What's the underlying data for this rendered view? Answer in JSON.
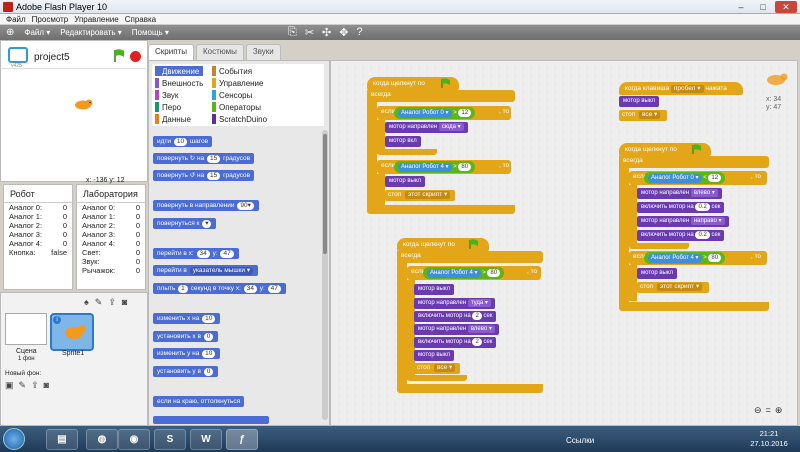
{
  "window": {
    "title": "Adobe Flash Player 10"
  },
  "menu": {
    "items": [
      "Файл",
      "Просмотр",
      "Управление",
      "Справка"
    ]
  },
  "toolbar": {
    "file": "Файл ▾",
    "edit": "Редактировать ▾",
    "help": "Помощь ▾"
  },
  "stage": {
    "project": "project5",
    "coords": "x: -136  y: 12",
    "tiny_label": "v425"
  },
  "boards": {
    "robot": {
      "title": "Робот",
      "rows": [
        {
          "k": "Аналог 0:",
          "v": "0"
        },
        {
          "k": "Аналог 1:",
          "v": "0"
        },
        {
          "k": "Аналог 2:",
          "v": "0"
        },
        {
          "k": "Аналог 3:",
          "v": "0"
        },
        {
          "k": "Аналог 4:",
          "v": "0"
        },
        {
          "k": "Кнопка:",
          "v": "false"
        }
      ]
    },
    "lab": {
      "title": "Лаборатория",
      "rows": [
        {
          "k": "Аналог 0:",
          "v": "0"
        },
        {
          "k": "Аналог 1:",
          "v": "0"
        },
        {
          "k": "Аналог 2:",
          "v": "0"
        },
        {
          "k": "Аналог 3:",
          "v": "0"
        },
        {
          "k": "Аналог 4:",
          "v": "0"
        },
        {
          "k": "Свет:",
          "v": "0"
        },
        {
          "k": "Звук:",
          "v": "0"
        },
        {
          "k": "Рычажок:",
          "v": "0"
        }
      ]
    }
  },
  "sprites": {
    "stage_label": "Сцена",
    "stage_sub": "1 фон",
    "new_bg": "Новый фон:",
    "sprite_name": "Sprite1"
  },
  "tabs": [
    "Скрипты",
    "Костюмы",
    "Звуки"
  ],
  "categories": [
    {
      "label": "Движение",
      "color": "#4a6cd4"
    },
    {
      "label": "События",
      "color": "#c88330"
    },
    {
      "label": "Внешность",
      "color": "#8a55d7"
    },
    {
      "label": "Управление",
      "color": "#e1a91a"
    },
    {
      "label": "Звук",
      "color": "#bb42c3"
    },
    {
      "label": "Сенсоры",
      "color": "#2ca5e2"
    },
    {
      "label": "Перо",
      "color": "#0e9a6c"
    },
    {
      "label": "Операторы",
      "color": "#5cb712"
    },
    {
      "label": "Данные",
      "color": "#ee7d16"
    },
    {
      "label": "ScratchDuino",
      "color": "#632d99"
    }
  ],
  "palette": {
    "b1": "идти",
    "b1n": "10",
    "b1b": "шагов",
    "b2": "повернуть ↻ на",
    "b2n": "15",
    "b2b": "градусов",
    "b3": "повернуть ↺ на",
    "b3n": "15",
    "b3b": "градусов",
    "b4": "повернуть в направлении",
    "b4n": "90▾",
    "b5": "повернуться к",
    "b5d": "▾",
    "b6": "перейти в х:",
    "b6n": "34",
    "b6m": "у:",
    "b6o": "47",
    "b7": "перейти в",
    "b7d": "указатель мышки ▾",
    "b8": "плыть",
    "b8n": "1",
    "b8m": "секунд в точку х:",
    "b8o": "34",
    "b8p": "у:",
    "b8q": "47",
    "b9": "изменить х на",
    "b9n": "10",
    "b10": "установить х в",
    "b10n": "0",
    "b11": "изменить у на",
    "b11n": "10",
    "b12": "установить у в",
    "b12n": "0",
    "b13": "если на краю, оттолкнуться"
  },
  "scripts": {
    "s1": {
      "hat": "когда щелкнут по",
      "forever": "всегда",
      "if1": "если",
      "sens1": "Аналог Робот 0 ▾",
      "gt1": ">",
      "v1": "12",
      "then1": ", то",
      "m1": "мотор направлен",
      "m1d": "сюда ▾",
      "m2": "мотор вкл",
      "if2": "если",
      "sens2": "Аналог Робот 4 ▾",
      "gt2": ">",
      "v2": "80",
      "then2": ", то",
      "m3": "мотор выкл",
      "stop": "стоп",
      "stopd": "этот скрипт ▾"
    },
    "s2": {
      "hat": "когда клавиша",
      "key": "пробел ▾",
      "hat2": "нажата",
      "m1": "мотор выкл",
      "stop": "стоп",
      "stopd": "все ▾"
    },
    "s3": {
      "hat": "когда щелкнут по",
      "forever": "всегда",
      "if1": "если",
      "sens1": "Аналог Робот 0 ▾",
      "lt": "<",
      "v1": "12",
      "then1": ", то",
      "m1": "мотор направлен",
      "m1d": "влево ▾",
      "m2": "включить мотор на",
      "m2n": "0.2",
      "m2b": "сек",
      "m3": "мотор направлен",
      "m3d": "направо ▾",
      "m4": "включить мотор на",
      "m4n": "0.2",
      "m4b": "сек",
      "if2": "если",
      "sens2": "Аналог Робот 4 ▾",
      "gt2": ">",
      "v2": "80",
      "then2": ", то",
      "m5": "мотор выкл",
      "stop": "стоп",
      "stopd": "этот скрипт ▾"
    },
    "s4": {
      "hat": "когда щелкнут по",
      "forever": "всегда",
      "if1": "если",
      "sens1": "Аналог Робот 4 ▾",
      "gt": ">",
      "v1": "80",
      "then1": ", то",
      "m1": "мотор выкл",
      "m2": "мотор направлен",
      "m2d": "туда ▾",
      "m3": "включить мотор на",
      "m3n": "2",
      "m3b": "сек",
      "m4": "мотор направлен",
      "m4d": "влево ▾",
      "m5": "включить мотор на",
      "m5n": "2",
      "m5b": "сек",
      "m6": "мотор выкл",
      "stop": "стоп",
      "stopd": "все ▾"
    }
  },
  "sprite_info": {
    "x": "x: 34",
    "y": "y: 47"
  },
  "taskbar": {
    "links": "Ссылки",
    "time": "21:21",
    "date": "27.10.2016"
  }
}
